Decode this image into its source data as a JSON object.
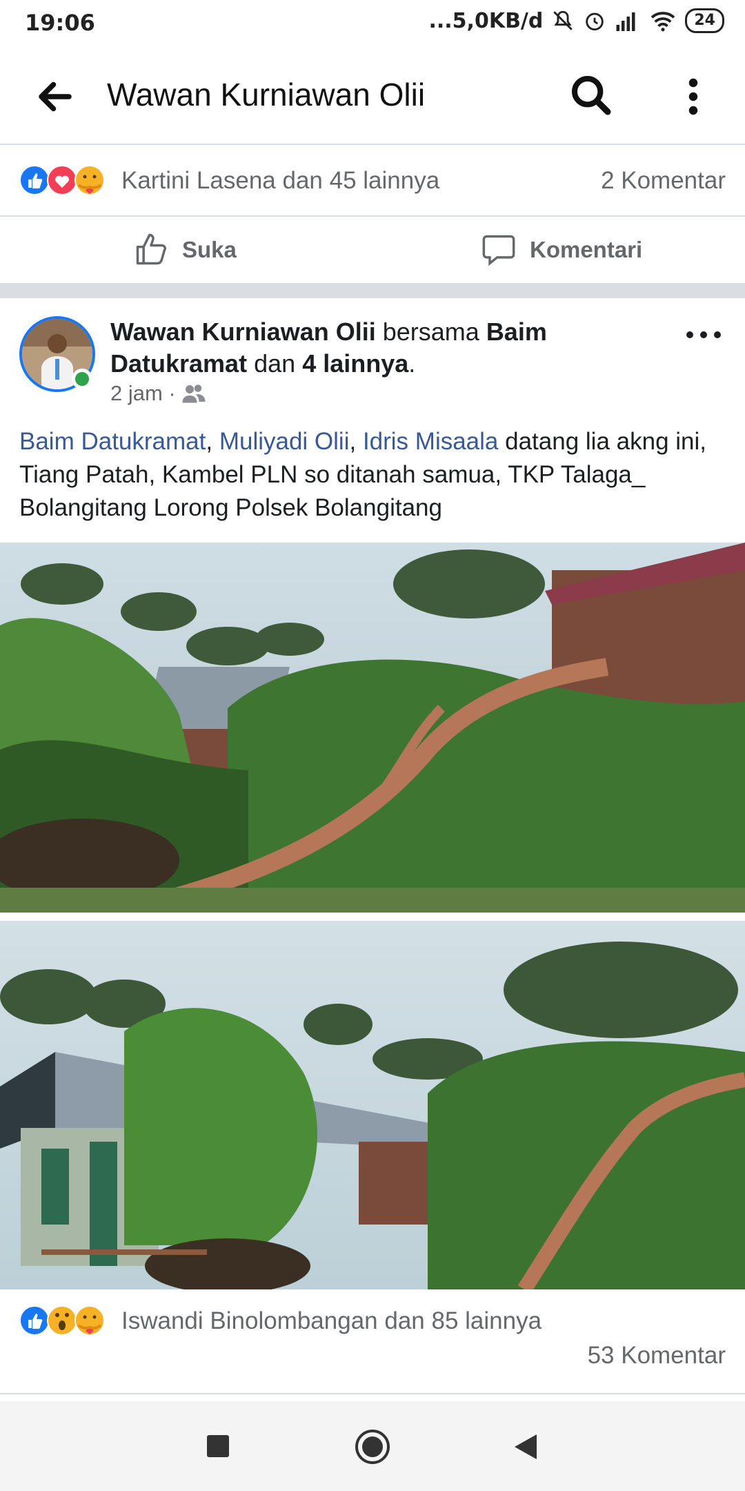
{
  "status_bar": {
    "time": "19:06",
    "net_speed": "...5,0KB/d",
    "battery": "24"
  },
  "app_bar": {
    "title": "Wawan Kurniawan Olii"
  },
  "prev_post": {
    "reactions_text": "Kartini Lasena dan 45 lainnya",
    "comments": "2 Komentar",
    "like_label": "Suka",
    "comment_label": "Komentari"
  },
  "post": {
    "author": "Wawan Kurniawan Olii",
    "with_word": "bersama",
    "tagged": "Baim Datukramat",
    "and_word": "dan",
    "others": "4 lainnya",
    "time": "2 jam ·",
    "text_links": [
      "Baim Datukramat",
      "Muliyadi Olii",
      "Idris Misaala"
    ],
    "text_body": "datang lia akng ini, Tiang Patah, Kambel PLN so ditanah samua, TKP Talaga_ Bolangitang Lorong Polsek Bolangitang",
    "reactions_text": "Iswandi Binolombangan dan 85 lainnya",
    "comments": "53 Komentar"
  },
  "colors": {
    "link": "#385898",
    "like_blue": "#1877f2",
    "love_red": "#f33e58",
    "online_green": "#31a24c",
    "divider": "#dadde1",
    "meta_gray": "#65676b"
  },
  "icons": [
    "back-arrow-icon",
    "search-icon",
    "more-vert-icon",
    "like-reaction-icon",
    "love-reaction-icon",
    "care-reaction-icon",
    "wow-reaction-icon",
    "thumbs-up-icon",
    "comment-bubble-icon",
    "friends-audience-icon",
    "more-horiz-icon",
    "recents-icon",
    "home-icon",
    "back-nav-icon"
  ]
}
